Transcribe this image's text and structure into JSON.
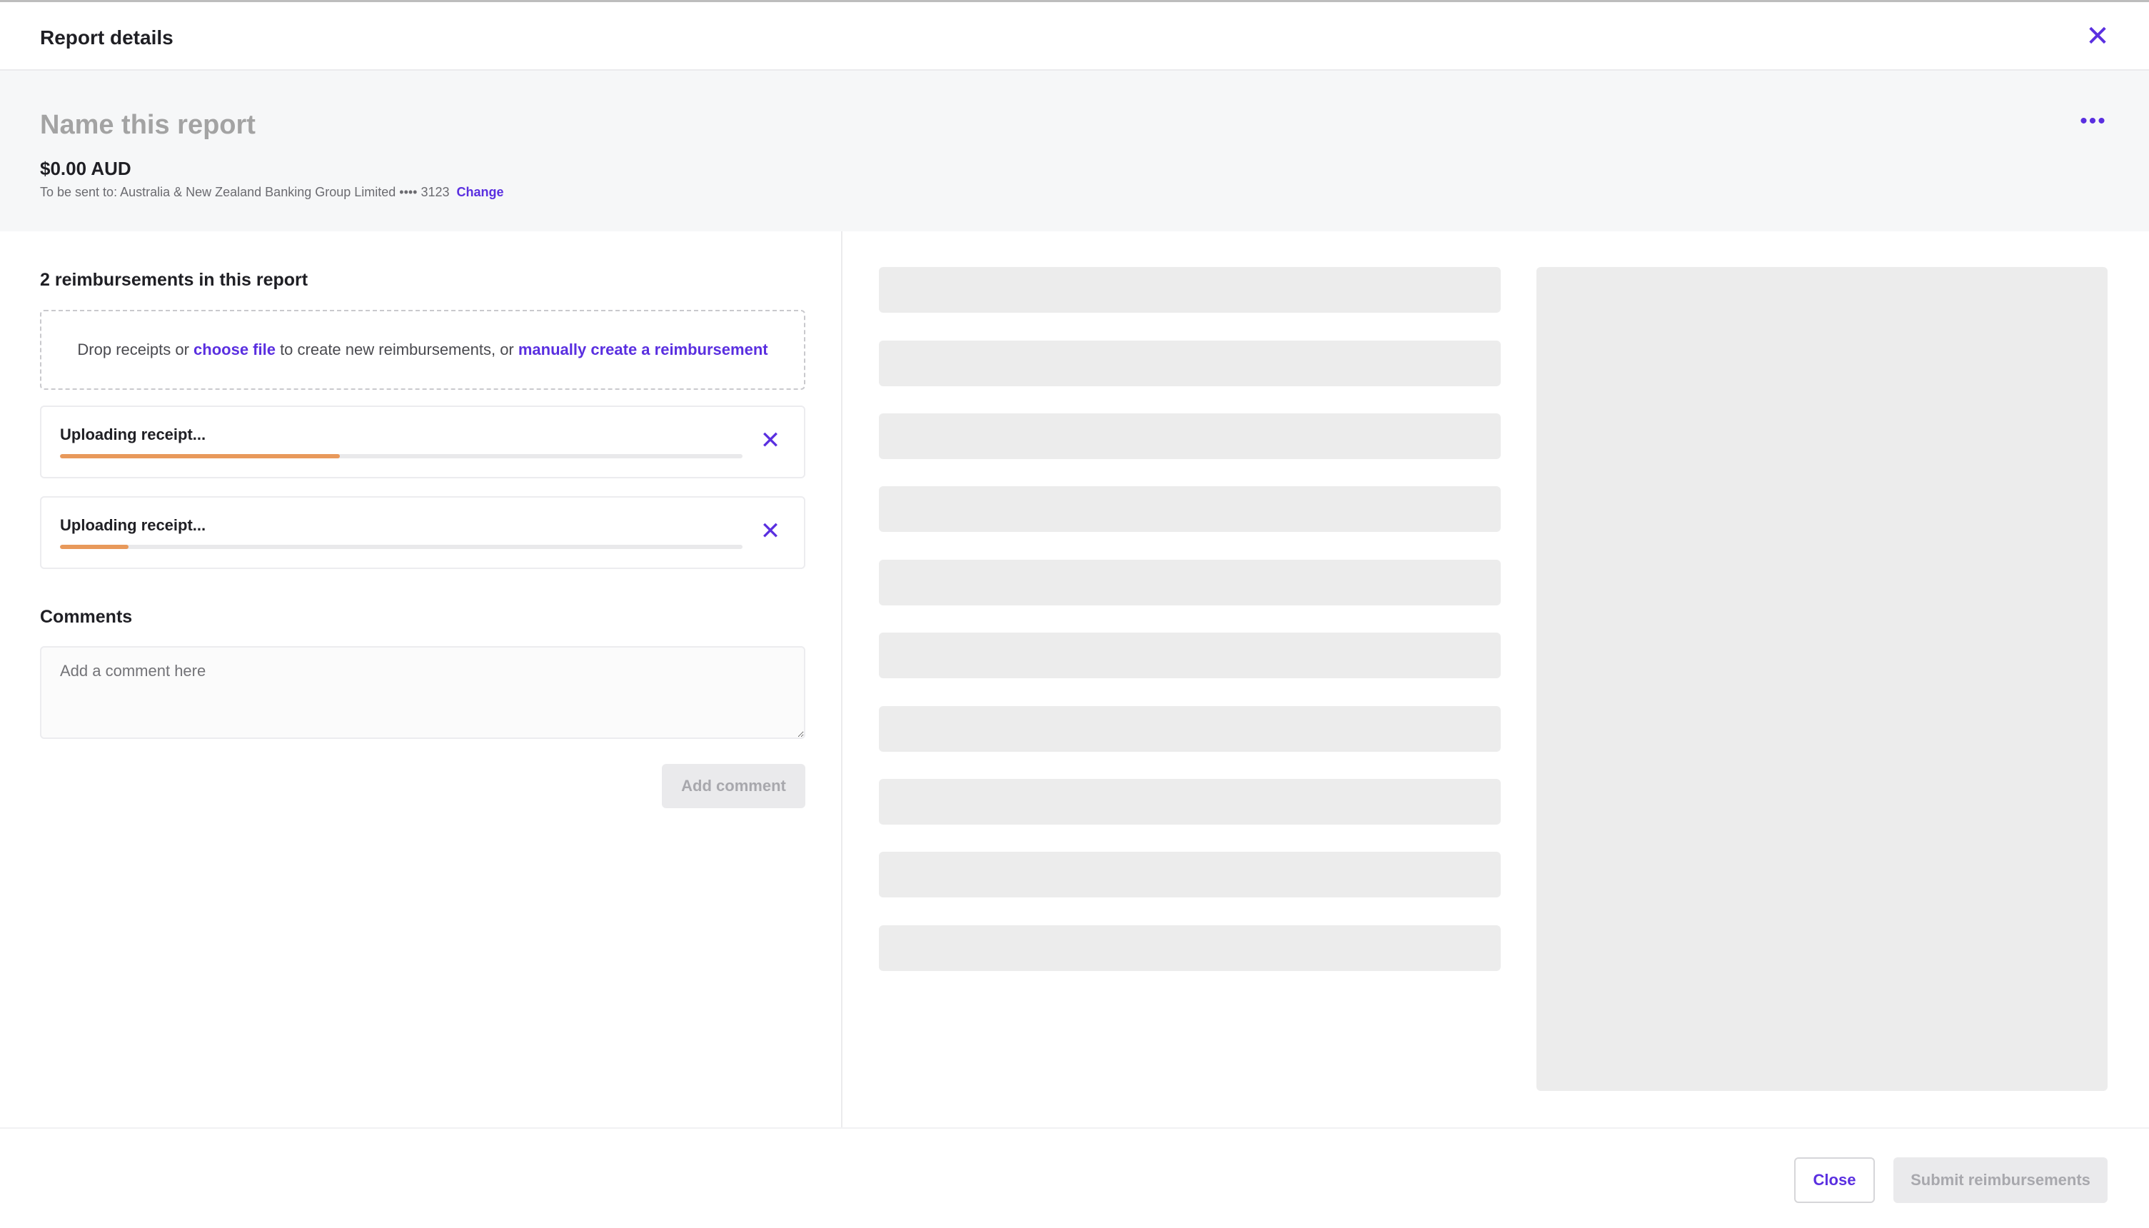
{
  "header": {
    "title": "Report details",
    "close_icon": "close-icon"
  },
  "summary": {
    "name_placeholder": "Name this report",
    "more_label": "•••",
    "amount": "$0.00 AUD",
    "send_to_text": "To be sent to: Australia & New Zealand Banking Group Limited •••• 3123",
    "change_label": "Change"
  },
  "reimbursements": {
    "title": "2 reimbursements in this report",
    "dropzone": {
      "text_before": "Drop receipts or ",
      "choose_file_label": "choose file",
      "text_middle": " to create new reimbursements, or ",
      "manual_label": "manually create a reimbursement"
    },
    "uploads": [
      {
        "label": "Uploading receipt...",
        "progress": 0.41
      },
      {
        "label": "Uploading receipt...",
        "progress": 0.1
      }
    ]
  },
  "comments": {
    "title": "Comments",
    "placeholder": "Add a comment here",
    "add_label": "Add comment"
  },
  "footer": {
    "close_label": "Close",
    "submit_label": "Submit reimbursements"
  },
  "colors": {
    "accent": "#5a2fe0",
    "progress": "#e8995b",
    "skeleton": "#ececec"
  }
}
